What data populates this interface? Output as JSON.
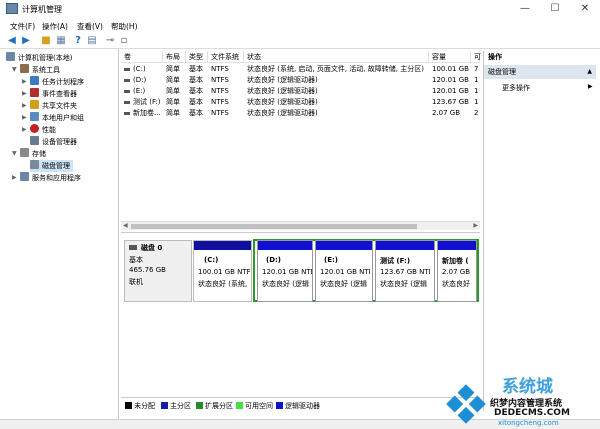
{
  "window": {
    "title": "计算机管理",
    "controls": [
      "minimize-icon",
      "maximize-icon",
      "close-icon"
    ]
  },
  "menu": [
    "文件(F)",
    "操作(A)",
    "查看(V)",
    "帮助(H)"
  ],
  "toolbar": [
    "back-icon",
    "forward-icon",
    "up-folder-icon",
    "show-tree-icon",
    "help-icon",
    "properties-icon",
    "connect-icon",
    "disk-list-icon"
  ],
  "tree": {
    "root": "计算机管理(本地)",
    "items": [
      {
        "label": "系统工具",
        "level": 1
      },
      {
        "label": "任务计划程序",
        "level": 2
      },
      {
        "label": "事件查看器",
        "level": 2
      },
      {
        "label": "共享文件夹",
        "level": 2
      },
      {
        "label": "本地用户和组",
        "level": 2
      },
      {
        "label": "性能",
        "level": 2
      },
      {
        "label": "设备管理器",
        "level": 2
      },
      {
        "label": "存储",
        "level": 1
      },
      {
        "label": "磁盘管理",
        "level": 2,
        "selected": true
      },
      {
        "label": "服务和应用程序",
        "level": 1
      }
    ]
  },
  "volumes": {
    "headers": [
      "卷",
      "布局",
      "类型",
      "文件系统",
      "状态",
      "容量",
      "可"
    ],
    "rows": [
      [
        "(C:)",
        "简单",
        "基本",
        "NTFS",
        "状态良好 (系统, 启动, 页面文件, 活动, 故障转储, 主分区)",
        "100.01 GB",
        "7"
      ],
      [
        "(D:)",
        "简单",
        "基本",
        "NTFS",
        "状态良好 (逻辑驱动器)",
        "120.01 GB",
        "1"
      ],
      [
        "(E:)",
        "简单",
        "基本",
        "NTFS",
        "状态良好 (逻辑驱动器)",
        "120.01 GB",
        "1"
      ],
      [
        "测试 (F:)",
        "简单",
        "基本",
        "NTFS",
        "状态良好 (逻辑驱动器)",
        "123.67 GB",
        "1"
      ],
      [
        "新加卷...",
        "简单",
        "基本",
        "NTFS",
        "状态良好 (逻辑驱动器)",
        "2.07 GB",
        "2"
      ]
    ]
  },
  "disk": {
    "name": "磁盘 0",
    "type": "基本",
    "size": "465.76 GB",
    "status": "联机",
    "partitions": [
      {
        "name": "(C:)",
        "size": "100.01 GB NTF",
        "status": "状态良好 (系统,"
      },
      {
        "name": "(D:)",
        "size": "120.01 GB NTI",
        "status": "状态良好 (逻辑"
      },
      {
        "name": "(E:)",
        "size": "120.01 GB NTI",
        "status": "状态良好 (逻辑"
      },
      {
        "name": "测试  (F:)",
        "size": "123.67 GB NTI",
        "status": "状态良好 (逻辑"
      },
      {
        "name": "新加卷  (",
        "size": "2.07 GB",
        "status": "状态良好"
      }
    ]
  },
  "legend": [
    {
      "label": "未分配",
      "color": "#000000"
    },
    {
      "label": "主分区",
      "color": "#1a1aa8"
    },
    {
      "label": "扩展分区",
      "color": "#2a8a2a"
    },
    {
      "label": "可用空间",
      "color": "#44dd44"
    },
    {
      "label": "逻辑驱动器",
      "color": "#1010d0"
    }
  ],
  "actions": {
    "header": "操作",
    "section": "磁盘管理",
    "more": "更多操作"
  },
  "watermark": {
    "brand": "系统城",
    "line1": "织梦内容管理系统",
    "line2": "DEDECMS.COM",
    "line3": "xitongcheng.com"
  },
  "colors": {
    "primary_partition": "#1010a0",
    "extended_border": "#2a9a2a",
    "selection": "#cde4f7",
    "watermark_blue": "#1e8fd6"
  }
}
